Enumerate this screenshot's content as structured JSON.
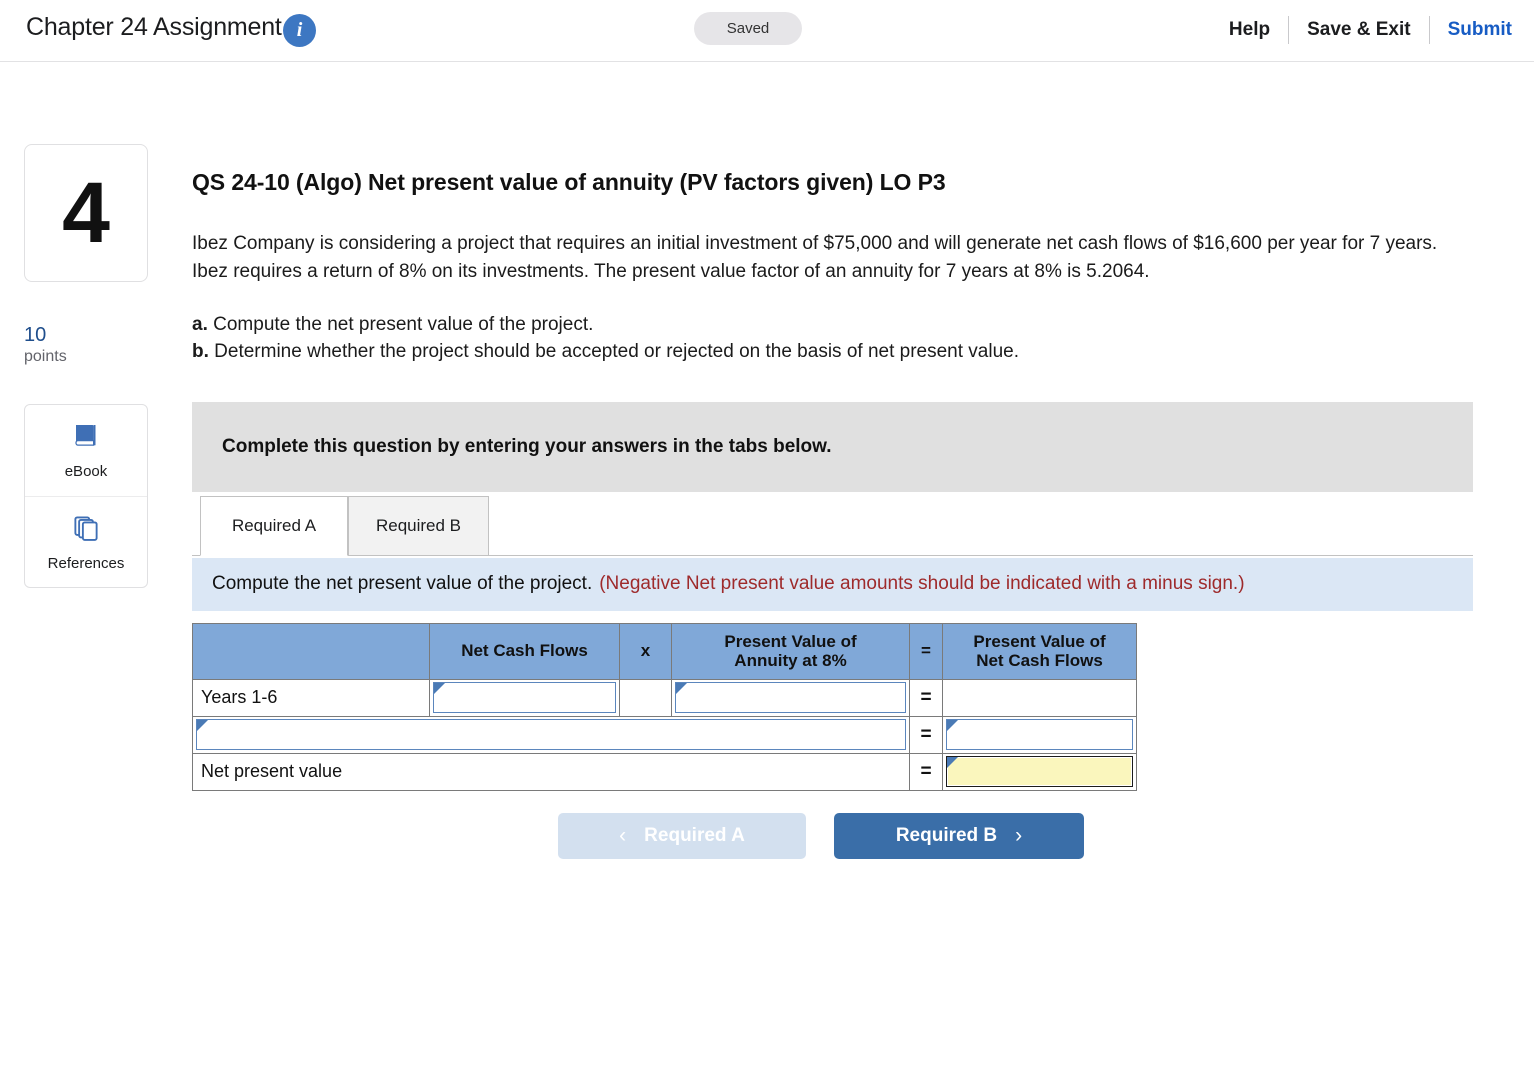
{
  "header": {
    "title": "Chapter 24 Assignment",
    "info_icon": "info-icon",
    "status": "Saved",
    "help": "Help",
    "save_exit": "Save & Exit",
    "submit": "Submit"
  },
  "rail": {
    "question_number": "4",
    "points_value": "10",
    "points_label": "points",
    "tools": [
      {
        "label": "eBook",
        "icon": "book-icon"
      },
      {
        "label": "References",
        "icon": "copy-pages-icon"
      }
    ]
  },
  "question": {
    "title": "QS 24-10 (Algo) Net present value of annuity (PV factors given) LO P3",
    "body": "Ibez Company is considering a project that requires an initial investment of $75,000 and will generate net cash flows of $16,600 per year for 7 years. Ibez requires a return of 8% on its investments. The present value factor of an annuity for 7 years at 8% is 5.2064.",
    "part_a_label": "a.",
    "part_a": " Compute the net present value of the project.",
    "part_b_label": "b.",
    "part_b": " Determine whether the project should be accepted or rejected on the basis of net present value."
  },
  "banner": {
    "text": "Complete this question by entering your answers in the tabs below."
  },
  "tabs": [
    {
      "label": "Required A",
      "active": true
    },
    {
      "label": "Required B",
      "active": false
    }
  ],
  "prompt": {
    "text": "Compute the net present value of the project.",
    "note": "(Negative Net present value amounts should be indicated with a minus sign.)"
  },
  "table": {
    "headers": [
      "",
      "Net Cash Flows",
      "x",
      "Present Value of Annuity at 8%",
      "=",
      "Present Value of Net Cash Flows"
    ],
    "header_lines": {
      "pv_annuity_l1": "Present Value of",
      "pv_annuity_l2": "Annuity at 8%",
      "pv_ncf_l1": "Present Value of",
      "pv_ncf_l2": "Net Cash Flows"
    },
    "rows": [
      {
        "label": "Years 1-6",
        "net_cash_flows": "",
        "operator_x": "",
        "pv_annuity": "",
        "operator_eq": "=",
        "pv_net_cash_flows": ""
      },
      {
        "label": "",
        "operator_eq": "=",
        "pv_net_cash_flows": ""
      },
      {
        "label": "Net present value",
        "operator_eq": "=",
        "pv_net_cash_flows": ""
      }
    ]
  },
  "nav": {
    "prev_label": "Required A",
    "prev_chevron": "chevron-left-icon",
    "next_label": "Required B",
    "next_chevron": "chevron-right-icon"
  },
  "colors": {
    "table_header_blue": "#80a8d8",
    "prompt_blue": "#dbe7f5",
    "banner_gray": "#e0e0e0",
    "note_red": "#9e2a2b",
    "accent_blue": "#175cc4",
    "next_button_blue": "#3a6ea8",
    "highlight_yellow": "#faf6bd"
  }
}
